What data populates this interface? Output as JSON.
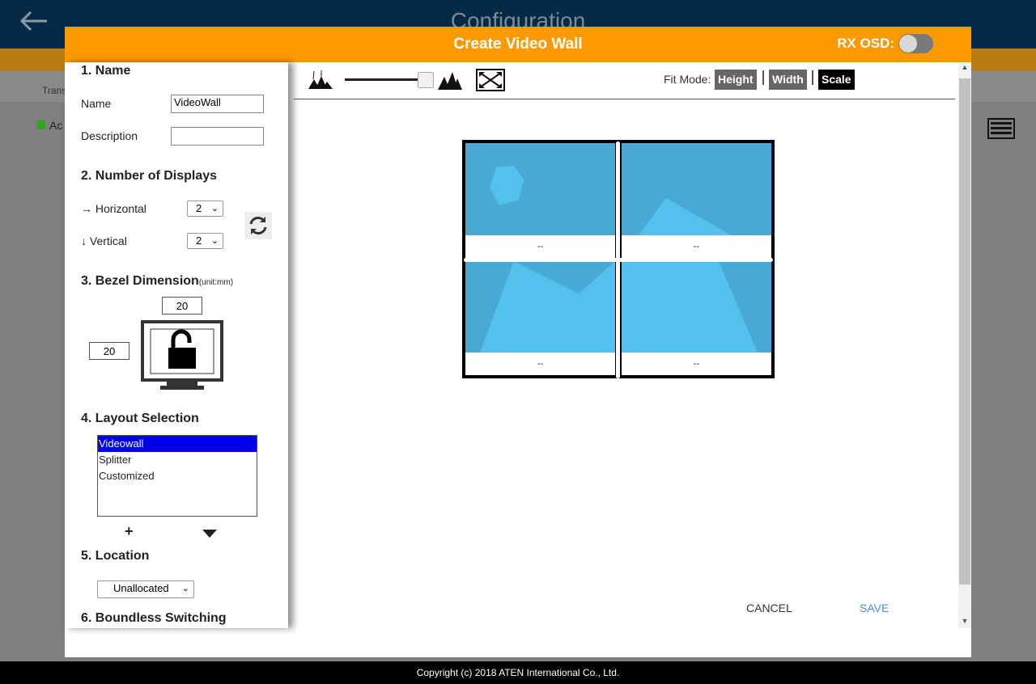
{
  "background": {
    "title": "Configuration",
    "tab_text": "Trans",
    "status_text": "Ac"
  },
  "modal": {
    "title": "Create Video Wall",
    "rx_osd_label": "RX OSD:",
    "rx_osd_on": false
  },
  "form": {
    "section1": "1. Name",
    "name_label": "Name",
    "name_value": "VideoWall",
    "description_label": "Description",
    "description_value": "",
    "section2": "2. Number of Displays",
    "horizontal_label": "→ Horizontal",
    "horizontal_value": "2",
    "vertical_label": "↓ Vertical",
    "vertical_value": "2",
    "section3": "3. Bezel Dimension",
    "section3_unit": "(unit:mm)",
    "bezel_top": "20",
    "bezel_left": "20",
    "section4": "4. Layout Selection",
    "layouts": [
      "Videowall",
      "Splitter",
      "Customized"
    ],
    "selected_layout": "Videowall",
    "add_symbol": "+",
    "section5": "5. Location",
    "location_value": "Unallocated",
    "section6": "6. Boundless Switching"
  },
  "toolbar": {
    "fit_mode_label": "Fit Mode:",
    "fit_height": "Height",
    "fit_width": "Width",
    "fit_scale": "Scale",
    "active_fit": "Scale"
  },
  "wall": {
    "rows": 2,
    "cols": 2,
    "cells": [
      "--",
      "--",
      "--",
      "--"
    ]
  },
  "actions": {
    "cancel": "CANCEL",
    "save": "SAVE"
  },
  "footer": {
    "copyright": "Copyright (c) 2018 ATEN International Co., Ltd."
  },
  "colors": {
    "header_orange": "#ff9900",
    "selected_blue": "#0000ee",
    "tile_blue": "#48a9d4",
    "save_blue": "#4a8fd8"
  }
}
